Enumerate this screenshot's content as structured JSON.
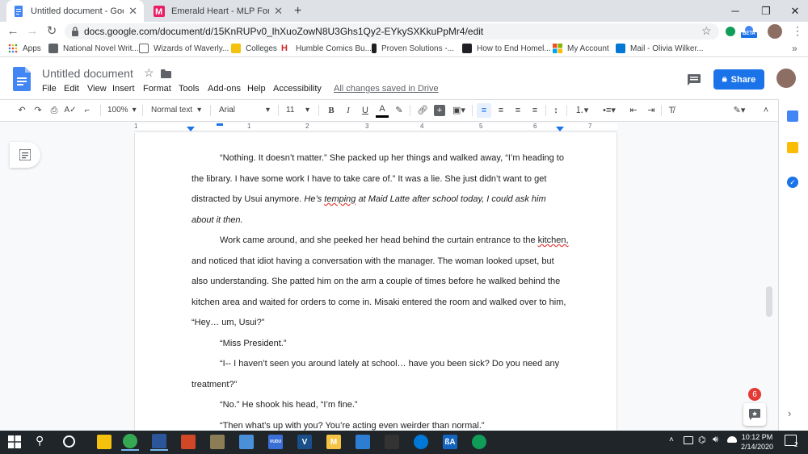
{
  "browser": {
    "tabs": [
      {
        "title": "Untitled document - Google Doc",
        "active": true
      },
      {
        "title": "Emerald Heart - MLP Forums",
        "active": false
      }
    ],
    "new_tab": "+",
    "url": "docs.google.com/document/d/15KnRUPv0_lhXuoZowN8U3Ghs1Qy2-EYkySXKkuPpMr4/edit",
    "beta_badge": "BETA",
    "bookmarks": [
      {
        "label": "Apps",
        "icon": "apps-grid-icon",
        "color": "#ea4335"
      },
      {
        "label": "National Novel Writ...",
        "icon": "nanowrimo-icon",
        "color": "#5f6368"
      },
      {
        "label": "Wizards of Waverly...",
        "icon": "wizards-icon",
        "color": "#5f6368"
      },
      {
        "label": "Colleges",
        "icon": "folder-icon",
        "color": "#f4c20d"
      },
      {
        "label": "Humble Comics Bu...",
        "icon": "humble-icon",
        "color": "#cc2929"
      },
      {
        "label": "Proven Solutions -...",
        "icon": "bookmark-icon",
        "color": "#202124"
      },
      {
        "label": "How to End Homel...",
        "icon": "arrow-icon",
        "color": "#202124"
      },
      {
        "label": "My Account",
        "icon": "microsoft-icon",
        "color": "#f25022"
      },
      {
        "label": "Mail - Olivia Wilker...",
        "icon": "outlook-icon",
        "color": "#0078d4"
      }
    ]
  },
  "docs": {
    "title": "Untitled document",
    "menus": [
      "File",
      "Edit",
      "View",
      "Insert",
      "Format",
      "Tools",
      "Add-ons",
      "Help",
      "Accessibility"
    ],
    "saved_status": "All changes saved in Drive",
    "share_label": "Share",
    "toolbar": {
      "zoom": "100%",
      "style": "Normal text",
      "font": "Arial",
      "size": "11"
    },
    "ruler_numbers": [
      "1",
      "1",
      "2",
      "3",
      "4",
      "5",
      "6",
      "7"
    ],
    "notification_count": "6"
  },
  "document": {
    "lines": [
      {
        "indent": true,
        "segments": [
          {
            "text": "“Nothing. It doesn’t matter.” She packed up her things and walked away, “I’m heading to"
          }
        ]
      },
      {
        "indent": false,
        "segments": [
          {
            "text": "the library. I have some work I have to take care of.” It was a lie. She just didn’t want to get"
          }
        ]
      },
      {
        "indent": false,
        "segments": [
          {
            "text": "distracted by Usui anymore. "
          },
          {
            "text": "He’s ",
            "italic": true
          },
          {
            "text": "temping",
            "italic": true,
            "spell": true
          },
          {
            "text": " at Maid Latte after school today, I could ask him",
            "italic": true
          }
        ]
      },
      {
        "indent": false,
        "segments": [
          {
            "text": "about it then.",
            "italic": true
          }
        ]
      },
      {
        "indent": true,
        "segments": [
          {
            "text": "Work came around, and she peeked her head behind the curtain entrance to the "
          },
          {
            "text": "kitchen,",
            "spell": true
          }
        ]
      },
      {
        "indent": false,
        "segments": [
          {
            "text": "and noticed that idiot having a conversation with the manager. The woman looked upset, but"
          }
        ]
      },
      {
        "indent": false,
        "segments": [
          {
            "text": "also understanding. She patted him on the arm a couple of times before he walked behind the"
          }
        ]
      },
      {
        "indent": false,
        "segments": [
          {
            "text": "kitchen area and waited for orders to come in. Misaki entered the room and walked over to him,"
          }
        ]
      },
      {
        "indent": false,
        "segments": [
          {
            "text": "“Hey… um, Usui?”"
          }
        ]
      },
      {
        "indent": true,
        "segments": [
          {
            "text": "“Miss President.”"
          }
        ]
      },
      {
        "indent": true,
        "segments": [
          {
            "text": "“I-- I haven’t seen you around lately at school… have you been sick? Do you need any"
          }
        ]
      },
      {
        "indent": false,
        "segments": [
          {
            "text": "treatment?”"
          }
        ]
      },
      {
        "indent": true,
        "segments": [
          {
            "text": "“No.” He shook his head, “I’m fine.”"
          }
        ]
      },
      {
        "indent": true,
        "segments": [
          {
            "text": "“Then what’s up with you? You’re acting even weirder than normal.”"
          }
        ]
      }
    ]
  },
  "taskbar": {
    "apps": [
      {
        "name": "file-explorer-icon",
        "color": "#f4c20d"
      },
      {
        "name": "chrome-icon",
        "color": "#34a853"
      },
      {
        "name": "word-icon",
        "color": "#2b579a"
      },
      {
        "name": "powerpoint-icon",
        "color": "#d24726"
      },
      {
        "name": "gimp-icon",
        "color": "#8b7d55"
      },
      {
        "name": "notepad-icon",
        "color": "#4a90d9"
      },
      {
        "name": "vudu-icon",
        "color": "#3a6fd8"
      },
      {
        "name": "v-app-icon",
        "color": "#1a4f8a"
      },
      {
        "name": "m-app-icon",
        "color": "#f6c445"
      },
      {
        "name": "sticky-icon",
        "color": "#2d7dd2"
      },
      {
        "name": "star-app-icon",
        "color": "#333333"
      },
      {
        "name": "edge-icon",
        "color": "#0078d7"
      },
      {
        "name": "fa-app-icon",
        "color": "#1565c0"
      },
      {
        "name": "hangouts-icon",
        "color": "#0f9d58"
      }
    ],
    "app_labels": {
      "v": "V",
      "m": "M",
      "fa": "ßA",
      "vudu": "VUDU"
    },
    "time": "10:12 PM",
    "date": "2/14/2020",
    "notifications": "2"
  },
  "colors": {
    "accent": "#1a73e8",
    "tab_bg": "#dee1e6",
    "taskbar": "#1f2529"
  }
}
